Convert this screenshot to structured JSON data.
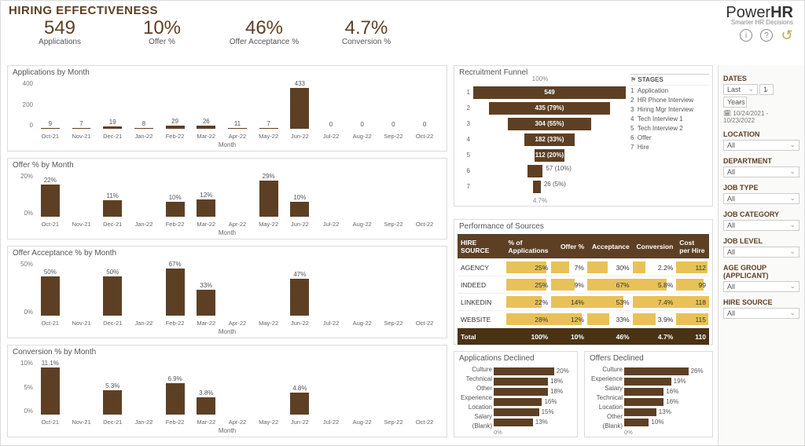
{
  "title": "HIRING EFFECTIVENESS",
  "brand": {
    "name_a": "Power",
    "name_b": "HR",
    "tag": "Smarter HR Decisions"
  },
  "kpis": [
    {
      "value": "549",
      "label": "Applications"
    },
    {
      "value": "10%",
      "label": "Offer %"
    },
    {
      "value": "46%",
      "label": "Offer Acceptance %"
    },
    {
      "value": "4.7%",
      "label": "Conversion %"
    }
  ],
  "months": [
    "Oct-21",
    "Nov-21",
    "Dec-21",
    "Jan-22",
    "Feb-22",
    "Mar-22",
    "Apr-22",
    "May-22",
    "Jun-22",
    "Jul-22",
    "Aug-22",
    "Sep-22",
    "Oct-22"
  ],
  "axis_label": "Month",
  "charts": {
    "apps": {
      "title": "Applications by Month",
      "ymax": 450,
      "yticks": [
        "400",
        "200",
        "0"
      ],
      "values": [
        9,
        7,
        19,
        8,
        29,
        26,
        11,
        7,
        433,
        0,
        0,
        0,
        0
      ],
      "labels": [
        "9",
        "7",
        "19",
        "8",
        "29",
        "26",
        "11",
        "7",
        "433",
        "0",
        "0",
        "0",
        "0"
      ]
    },
    "offer": {
      "title": "Offer % by Month",
      "ymax": 30,
      "yticks": [
        "20%",
        "0%"
      ],
      "values": [
        22,
        0,
        11,
        0,
        10,
        12,
        0,
        29,
        10,
        0,
        0,
        0,
        0
      ],
      "labels": [
        "22%",
        "",
        "11%",
        "",
        "10%",
        "12%",
        "",
        "29%",
        "10%",
        "",
        "",
        "",
        ""
      ]
    },
    "acc": {
      "title": "Offer Acceptance % by Month",
      "ymax": 70,
      "yticks": [
        "50%",
        "0%"
      ],
      "values": [
        50,
        0,
        50,
        0,
        67,
        33,
        0,
        0,
        47,
        0,
        0,
        0,
        0
      ],
      "labels": [
        "50%",
        "",
        "50%",
        "",
        "67%",
        "33%",
        "",
        "",
        "47%",
        "",
        "",
        "",
        ""
      ]
    },
    "conv": {
      "title": "Conversion % by Month",
      "ymax": 12,
      "yticks": [
        "10%",
        "5%",
        "0%"
      ],
      "values": [
        11.1,
        0,
        5.3,
        0,
        6.9,
        3.8,
        0,
        0,
        4.8,
        0,
        0,
        0,
        0
      ],
      "labels": [
        "11.1%",
        "",
        "5.3%",
        "",
        "6.9%",
        "3.8%",
        "",
        "",
        "4.8%",
        "",
        "",
        "",
        ""
      ]
    }
  },
  "funnel": {
    "title": "Recruitment Funnel",
    "top": "100%",
    "bottom": "4.7%",
    "stages_hdr": "STAGES",
    "stages": [
      "Application",
      "HR Phone Interview",
      "Hiring Mgr Interview",
      "Tech Interview 1",
      "Tech Interview 2",
      "Offer",
      "Hire"
    ],
    "bars": [
      {
        "w": 100,
        "text": "549"
      },
      {
        "w": 79,
        "text": "435 (79%)"
      },
      {
        "w": 55,
        "text": "304 (55%)"
      },
      {
        "w": 33,
        "text": "182 (33%)"
      },
      {
        "w": 20,
        "text": "112 (20%)"
      },
      {
        "w": 10,
        "text": "57 (10%)",
        "side": true
      },
      {
        "w": 5,
        "text": "26 (5%)",
        "side": true
      }
    ]
  },
  "sources": {
    "title": "Performance of Sources",
    "headers": [
      "HIRE SOURCE",
      "% of Applications",
      "Offer %",
      "Acceptance",
      "Conversion",
      "Cost per Hire"
    ],
    "rows": [
      {
        "name": "AGENCY",
        "pct": 25,
        "offer": 7,
        "acc": 30,
        "conv": 2.2,
        "cost": 112
      },
      {
        "name": "INDEED",
        "pct": 25,
        "offer": 9,
        "acc": 67,
        "conv": 5.8,
        "cost": 99
      },
      {
        "name": "LINKEDIN",
        "pct": 22,
        "offer": 14,
        "acc": 53,
        "conv": 7.4,
        "cost": 118
      },
      {
        "name": "WEBSITE",
        "pct": 28,
        "offer": 12,
        "acc": 33,
        "conv": 3.9,
        "cost": 115
      }
    ],
    "total": {
      "name": "Total",
      "pct": "100%",
      "offer": "10%",
      "acc": "46%",
      "conv": "4.7%",
      "cost": "110"
    }
  },
  "declined_apps": {
    "title": "Applications Declined",
    "zero": "0%",
    "max": 20,
    "rows": [
      [
        "Culture",
        20
      ],
      [
        "Technical",
        18
      ],
      [
        "Other",
        18
      ],
      [
        "Experience",
        16
      ],
      [
        "Location",
        15
      ],
      [
        "Salary",
        13
      ],
      [
        "(Blank)",
        0
      ]
    ]
  },
  "declined_offers": {
    "title": "Offers Declined",
    "zero": "0%",
    "max": 26,
    "rows": [
      [
        "Culture",
        26
      ],
      [
        "Experience",
        19
      ],
      [
        "Salary",
        16
      ],
      [
        "Technical",
        16
      ],
      [
        "Location",
        13
      ],
      [
        "Other",
        10
      ],
      [
        "(Blank)",
        0
      ]
    ]
  },
  "filters": {
    "dates": {
      "h": "DATES",
      "a": "Last",
      "b": "1",
      "c": "Years",
      "range": "10/24/2021 - 10/23/2022"
    },
    "items": [
      {
        "h": "LOCATION",
        "v": "All"
      },
      {
        "h": "DEPARTMENT",
        "v": "All"
      },
      {
        "h": "JOB TYPE",
        "v": "All"
      },
      {
        "h": "JOB CATEGORY",
        "v": "All"
      },
      {
        "h": "JOB LEVEL",
        "v": "All"
      },
      {
        "h": "AGE GROUP (APPLICANT)",
        "v": "All"
      },
      {
        "h": "HIRE SOURCE",
        "v": "All"
      }
    ]
  },
  "chart_data": {
    "type": "dashboard",
    "bar_charts": [
      {
        "type": "bar",
        "title": "Applications by Month",
        "categories": [
          "Oct-21",
          "Nov-21",
          "Dec-21",
          "Jan-22",
          "Feb-22",
          "Mar-22",
          "Apr-22",
          "May-22",
          "Jun-22",
          "Jul-22",
          "Aug-22",
          "Sep-22",
          "Oct-22"
        ],
        "values": [
          9,
          7,
          19,
          8,
          29,
          26,
          11,
          7,
          433,
          0,
          0,
          0,
          0
        ],
        "xlabel": "Month",
        "ylim": [
          0,
          450
        ]
      },
      {
        "type": "bar",
        "title": "Offer % by Month",
        "categories": [
          "Oct-21",
          "Nov-21",
          "Dec-21",
          "Jan-22",
          "Feb-22",
          "Mar-22",
          "Apr-22",
          "May-22",
          "Jun-22",
          "Jul-22",
          "Aug-22",
          "Sep-22",
          "Oct-22"
        ],
        "values": [
          22,
          null,
          11,
          null,
          10,
          12,
          null,
          29,
          10,
          null,
          null,
          null,
          null
        ],
        "xlabel": "Month",
        "ylim": [
          0,
          30
        ],
        "unit": "%"
      },
      {
        "type": "bar",
        "title": "Offer Acceptance % by Month",
        "categories": [
          "Oct-21",
          "Nov-21",
          "Dec-21",
          "Jan-22",
          "Feb-22",
          "Mar-22",
          "Apr-22",
          "May-22",
          "Jun-22",
          "Jul-22",
          "Aug-22",
          "Sep-22",
          "Oct-22"
        ],
        "values": [
          50,
          null,
          50,
          null,
          67,
          33,
          null,
          null,
          47,
          null,
          null,
          null,
          null
        ],
        "xlabel": "Month",
        "ylim": [
          0,
          70
        ],
        "unit": "%"
      },
      {
        "type": "bar",
        "title": "Conversion % by Month",
        "categories": [
          "Oct-21",
          "Nov-21",
          "Dec-21",
          "Jan-22",
          "Feb-22",
          "Mar-22",
          "Apr-22",
          "May-22",
          "Jun-22",
          "Jul-22",
          "Aug-22",
          "Sep-22",
          "Oct-22"
        ],
        "values": [
          11.1,
          null,
          5.3,
          null,
          6.9,
          3.8,
          null,
          null,
          4.8,
          null,
          null,
          null,
          null
        ],
        "xlabel": "Month",
        "ylim": [
          0,
          12
        ],
        "unit": "%"
      }
    ],
    "funnel": {
      "type": "funnel",
      "title": "Recruitment Funnel",
      "stages": [
        "Application",
        "HR Phone Interview",
        "Hiring Mgr Interview",
        "Tech Interview 1",
        "Tech Interview 2",
        "Offer",
        "Hire"
      ],
      "values": [
        549,
        435,
        304,
        182,
        112,
        57,
        26
      ],
      "pct": [
        100,
        79,
        55,
        33,
        20,
        10,
        5
      ]
    },
    "sources_table": {
      "type": "table",
      "title": "Performance of Sources",
      "columns": [
        "HIRE SOURCE",
        "% of Applications",
        "Offer %",
        "Acceptance",
        "Conversion",
        "Cost per Hire"
      ],
      "rows": [
        [
          "AGENCY",
          "25%",
          "7%",
          "30%",
          "2.2%",
          112
        ],
        [
          "INDEED",
          "25%",
          "9%",
          "67%",
          "5.8%",
          99
        ],
        [
          "LINKEDIN",
          "22%",
          "14%",
          "53%",
          "7.4%",
          118
        ],
        [
          "WEBSITE",
          "28%",
          "12%",
          "33%",
          "3.9%",
          115
        ],
        [
          "Total",
          "100%",
          "10%",
          "46%",
          "4.7%",
          110
        ]
      ]
    },
    "declined": [
      {
        "type": "bar",
        "title": "Applications Declined",
        "orientation": "h",
        "categories": [
          "Culture",
          "Technical",
          "Other",
          "Experience",
          "Location",
          "Salary",
          "(Blank)"
        ],
        "values": [
          20,
          18,
          18,
          16,
          15,
          13,
          0
        ],
        "unit": "%"
      },
      {
        "type": "bar",
        "title": "Offers Declined",
        "orientation": "h",
        "categories": [
          "Culture",
          "Experience",
          "Salary",
          "Technical",
          "Location",
          "Other",
          "(Blank)"
        ],
        "values": [
          26,
          19,
          16,
          16,
          13,
          10,
          0
        ],
        "unit": "%"
      }
    ]
  }
}
